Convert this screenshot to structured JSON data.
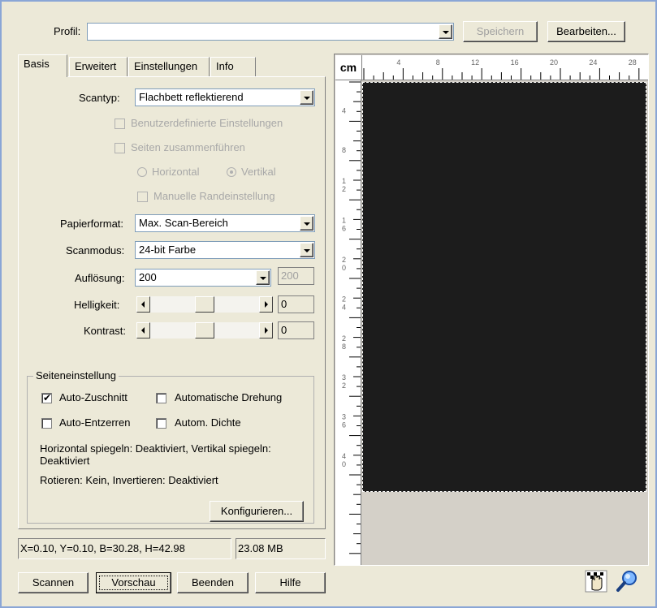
{
  "profile": {
    "label": "Profil:",
    "value": "",
    "save_button": "Speichern",
    "edit_button": "Bearbeiten..."
  },
  "tabs": [
    {
      "label": "Basis",
      "active": true
    },
    {
      "label": "Erweitert"
    },
    {
      "label": "Einstellungen"
    },
    {
      "label": "Info"
    }
  ],
  "basis": {
    "scantype_label": "Scantyp:",
    "scantype_value": "Flachbett reflektierend",
    "custom_settings": "Benutzerdefinierte Einstellungen",
    "merge_pages": "Seiten zusammenführen",
    "horizontal": "Horizontal",
    "vertical": "Vertikal",
    "manual_margin": "Manuelle Randeinstellung",
    "paper_label": "Papierformat:",
    "paper_value": "Max. Scan-Bereich",
    "mode_label": "Scanmodus:",
    "mode_value": "24-bit Farbe",
    "resolution_label": "Auflösung:",
    "resolution_value": "200",
    "resolution_custom": "200",
    "brightness_label": "Helligkeit:",
    "brightness_value": "0",
    "brightness_level": 0.5,
    "contrast_label": "Kontrast:",
    "contrast_value": "0",
    "contrast_level": 0.5
  },
  "page_settings": {
    "title": "Seiteneinstellung",
    "auto_crop": "Auto-Zuschnitt",
    "auto_rotate": "Automatische Drehung",
    "auto_deskew": "Auto-Entzerren",
    "auto_density": "Autom. Dichte",
    "info_line1": "Horizontal spiegeln: Deaktiviert, Vertikal spiegeln: Deaktiviert",
    "info_line2": "Rotieren: Kein, Invertieren: Deaktiviert",
    "configure_button": "Konfigurieren..."
  },
  "status": {
    "coords": "X=0.10, Y=0.10, B=30.28, H=42.98",
    "size": "23.08 MB"
  },
  "buttons": {
    "scan": "Scannen",
    "preview": "Vorschau",
    "exit": "Beenden",
    "help": "Hilfe"
  },
  "ruler": {
    "unit": "cm",
    "top_labels": [
      "4",
      "8",
      "12",
      "16",
      "20",
      "24",
      "28"
    ],
    "left_labels": [
      "4",
      "8",
      "12",
      "16",
      "20",
      "24",
      "28",
      "32",
      "36",
      "40"
    ]
  },
  "icons": {
    "hand_tool": "hand-pan-icon",
    "zoom_tool": "magnifier-zoom-icon"
  }
}
